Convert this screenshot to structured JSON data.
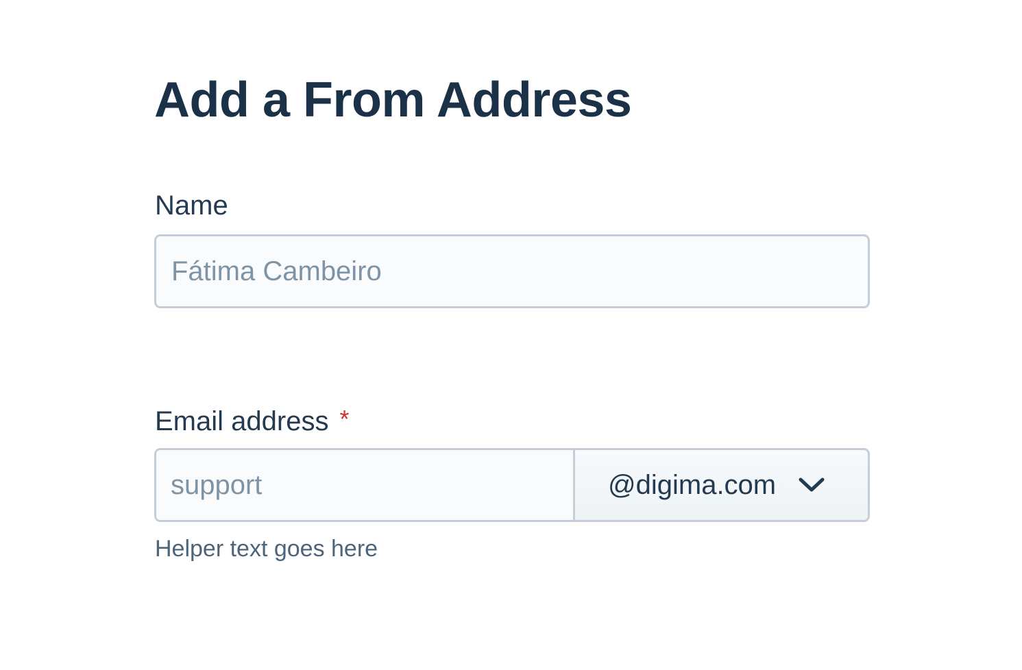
{
  "form": {
    "title": "Add a From Address",
    "name_field": {
      "label": "Name",
      "value": "",
      "placeholder": "Fátima Cambeiro"
    },
    "email_field": {
      "label": "Email address",
      "required_marker": "*",
      "local_value": "",
      "local_placeholder": "support",
      "domain_selected": "@digima.com",
      "helper_text": "Helper text goes here"
    }
  },
  "colors": {
    "heading": "#1b3148",
    "label": "#233a50",
    "placeholder": "#7d93a6",
    "border": "#c3ced8",
    "required": "#d0312d",
    "helper": "#4d657b"
  },
  "icons": {
    "domain_dropdown": "chevron-down-icon"
  }
}
